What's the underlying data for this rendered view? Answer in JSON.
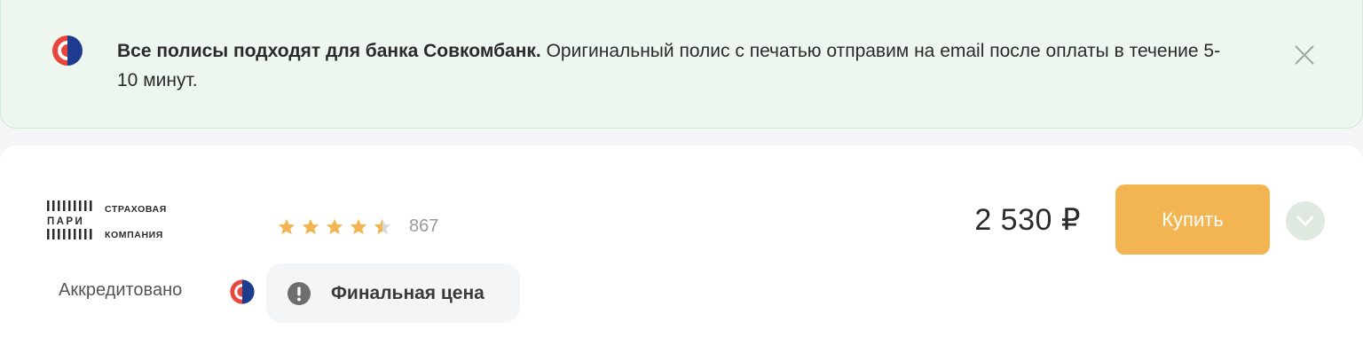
{
  "banner": {
    "bold_text": "Все полисы подходят для банка Совкомбанк.",
    "text": " Оригинальный полис с печатью отправим на email после оплаты в течение 5-10 минут.",
    "colors": {
      "background": "#eef7ef",
      "logo_red": "#e8453c",
      "logo_blue": "#1d3b8f"
    },
    "icons": {
      "logo": "sovcombank-logo-icon",
      "close": "close-icon"
    }
  },
  "offer": {
    "insurer": {
      "brand": "ПАРИ",
      "line1": "СТРАХОВАЯ",
      "line2": "КОМПАНИЯ"
    },
    "rating": {
      "value": 4.5,
      "max": 5,
      "count": "867",
      "star_color": "#f3b551"
    },
    "accredited_label": "Аккредитовано",
    "final_price_label": "Финальная цена",
    "price": "2 530 ₽",
    "buy_label": "Купить",
    "colors": {
      "buy_button": "#f3b551",
      "expand_button": "#dfe9e0"
    },
    "icons": {
      "info": "exclamation-icon",
      "expand": "chevron-down-icon"
    }
  }
}
